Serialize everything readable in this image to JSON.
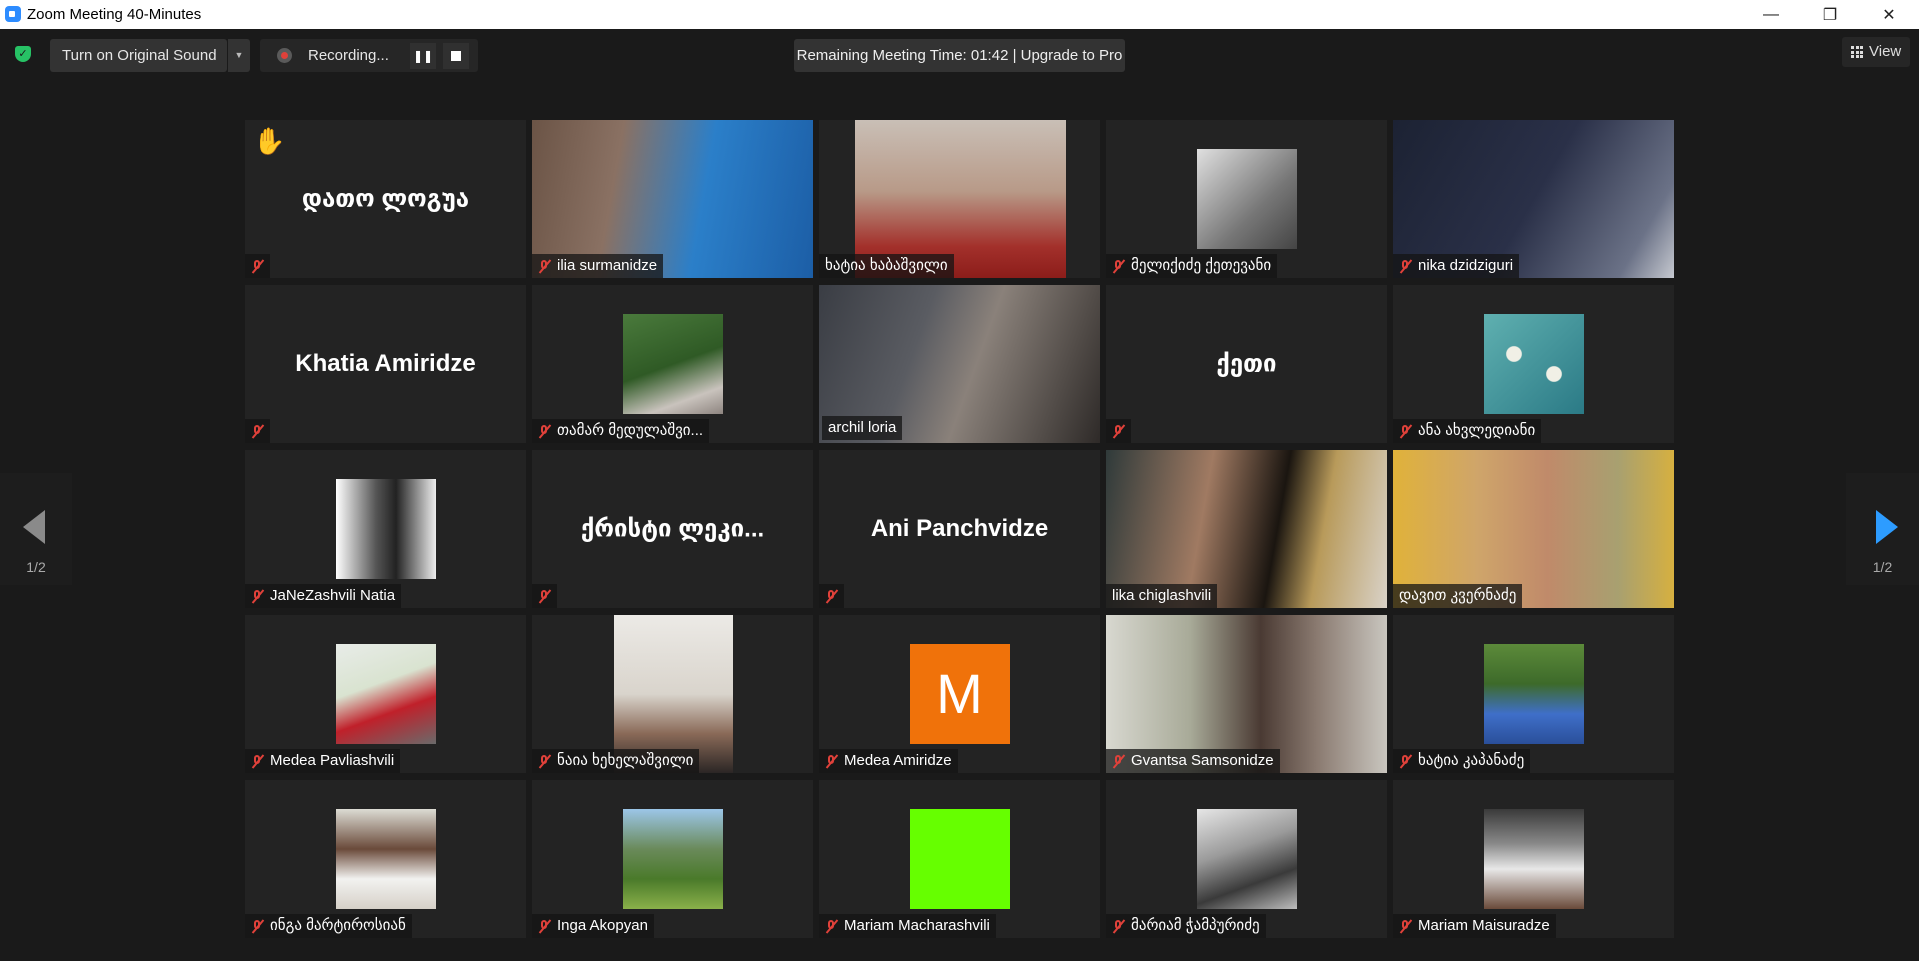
{
  "window": {
    "title": "Zoom Meeting 40-Minutes"
  },
  "toolbar": {
    "original_sound_label": "Turn on Original Sound",
    "recording_label": "Recording...",
    "remaining_time": "Remaining Meeting Time: 01:42 | Upgrade to Pro",
    "view_label": "View"
  },
  "pagination": {
    "left_indicator": "1/2",
    "right_indicator": "1/2"
  },
  "colors": {
    "active_speaker_border": "#d8f07a",
    "muted_red": "#e0413a",
    "avatar_orange": "#f0720a",
    "avatar_green": "#66ff00",
    "next_arrow": "#2d9cff"
  },
  "participants": [
    {
      "name": "დათო ლოგუა",
      "display_center": "დათო ლოგუა",
      "muted": true,
      "hand_raised": true
    },
    {
      "name": "ilia surmanidze",
      "muted": true,
      "video": "full"
    },
    {
      "name": "ხატია ხაბაშვილი",
      "muted": false,
      "video": "mid"
    },
    {
      "name": "მელიქიძე ქეთევანი",
      "muted": true,
      "video": "ctr"
    },
    {
      "name": "nika dzidziguri",
      "muted": true,
      "video": "full"
    },
    {
      "name": "Khatia Amiridze",
      "display_center": "Khatia Amiridze",
      "muted": true
    },
    {
      "name": "თამარ მედულაშვი...",
      "muted": true,
      "video": "ctr"
    },
    {
      "name": "archil loria",
      "muted": false,
      "video": "full",
      "active_speaker": true
    },
    {
      "name": "ქეთი",
      "display_center": "ქეთი",
      "muted": true
    },
    {
      "name": "ანა ახვლედიანი",
      "muted": true,
      "video": "ctr"
    },
    {
      "name": "JaNeZashvili Natia",
      "muted": true,
      "video": "ctr"
    },
    {
      "name": "ქრისტი ლეკი...",
      "display_center": "ქრისტი ლეკი...",
      "muted": true
    },
    {
      "name": "Ani Panchvidze",
      "display_center": "Ani Panchvidze",
      "muted": true
    },
    {
      "name": "lika chiglashvili",
      "muted": false,
      "video": "full"
    },
    {
      "name": "დავით კვერნაძე",
      "muted": false,
      "video": "full"
    },
    {
      "name": "Medea Pavliashvili",
      "muted": true,
      "video": "ctr"
    },
    {
      "name": "ნაია ხეხელაშვილი",
      "muted": true,
      "video": "nar"
    },
    {
      "name": "Medea Amiridze",
      "muted": true,
      "avatar_letter": "M"
    },
    {
      "name": "Gvantsa Samsonidze",
      "muted": true,
      "video": "full"
    },
    {
      "name": "ხატია კაპანაძე",
      "muted": true,
      "video": "ctr"
    },
    {
      "name": "ინგა მარტიროსიან",
      "muted": true,
      "video": "ctr"
    },
    {
      "name": "Inga Akopyan",
      "muted": true,
      "video": "ctr"
    },
    {
      "name": "Mariam Macharashvili",
      "muted": true,
      "avatar_green": true
    },
    {
      "name": "მარიამ ჭამპურიძე",
      "muted": true,
      "video": "ctr"
    },
    {
      "name": "Mariam Maisuradze",
      "muted": true,
      "video": "ctr"
    }
  ]
}
